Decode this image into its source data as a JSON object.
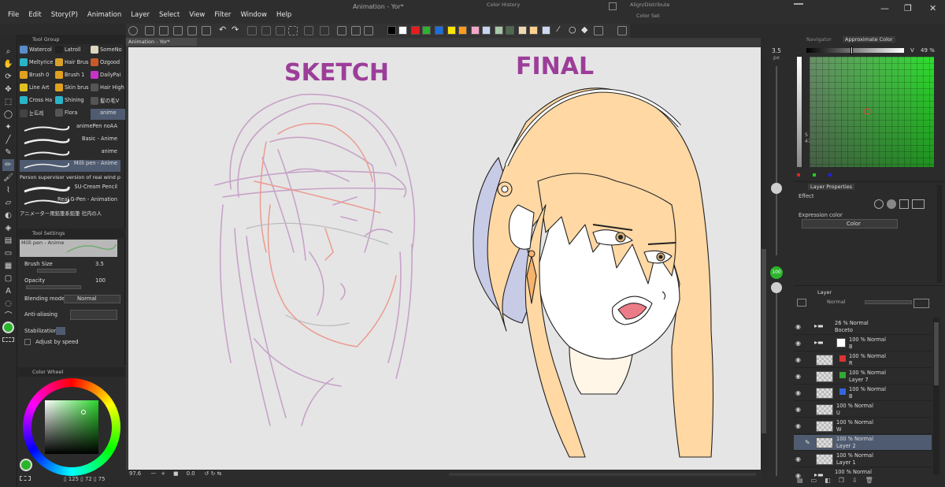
{
  "menu": [
    "File",
    "Edit",
    "Story(P)",
    "Animation",
    "Layer",
    "Select",
    "View",
    "Filter",
    "Window",
    "Help"
  ],
  "window": {
    "title": "Animation - Yor*",
    "color_history_caption": "Color History",
    "align_caption": "Align/Distribute",
    "color_set_caption": "Color Set",
    "controls": [
      "—",
      "❐",
      "✕"
    ]
  },
  "color_set": [
    "#000000",
    "#ffffff",
    "#e81c1c",
    "#2db32d",
    "#1a6fe0",
    "#ffe600",
    "#ff9a1e",
    "#f2a8c8",
    "#c9d6f0",
    "#a8c8a8",
    "#4f6a4f",
    "#f0d8b0",
    "#ffd090",
    "#d0d8f0"
  ],
  "tool_group": {
    "title": "Tool Group",
    "cells": [
      {
        "label": "Watercol",
        "color": "#5a8cc8"
      },
      {
        "label": "Latroll",
        "color": "#222222"
      },
      {
        "label": "SomeNo",
        "color": "#ddd7c0"
      },
      {
        "label": "Meltyrice",
        "color": "#2ab4c8"
      },
      {
        "label": "Hair Brus",
        "color": "#d8a22a"
      },
      {
        "label": "Ozgood",
        "color": "#c85a2a"
      },
      {
        "label": "Brush 0",
        "color": "#e0a020"
      },
      {
        "label": "Brush 1",
        "color": "#e0a020"
      },
      {
        "label": "DailyPai",
        "color": "#c832c8"
      },
      {
        "label": "Line Art",
        "color": "#e0c020"
      },
      {
        "label": "Skin brus",
        "color": "#e0a020"
      },
      {
        "label": "Hair High",
        "color": "#555555"
      },
      {
        "label": "Cross Ha",
        "color": "#2ab4c8"
      },
      {
        "label": "Shining",
        "color": "#2ab4c8"
      },
      {
        "label": "髪の毛V",
        "color": "#555555"
      },
      {
        "label": "눈트레 ",
        "color": "#444444"
      },
      {
        "label": "Flora",
        "color": "#555555"
      },
      {
        "label": "anime",
        "color": "#4f5b70"
      }
    ]
  },
  "brushes": [
    {
      "name": "animePen noAA",
      "selected": false
    },
    {
      "name": "Basic - Anime",
      "selected": false
    },
    {
      "name": "anime",
      "selected": false
    },
    {
      "name": "Milli pen - Anime",
      "selected": true
    },
    {
      "name": "Person supervisor version of real wind pen",
      "selected": false
    },
    {
      "name": "SU-Cream Pencil",
      "selected": false
    },
    {
      "name": "Real G-Pen - Animation",
      "selected": false
    },
    {
      "name": "アニメーター用鉛筆系鉛筆 社内の人",
      "selected": false
    }
  ],
  "tool_settings": {
    "title": "Tool Settings",
    "preset": "Milli pen - Anime",
    "brush_size_label": "Brush Size",
    "brush_size_value": "3.5",
    "opacity_label": "Opacity",
    "opacity_value": "100",
    "blending_label": "Blending mode",
    "blending_value": "Normal",
    "anti_aliasing_label": "Anti-aliasing",
    "stabilization_label": "Stabilization",
    "adjust_speed_label": "Adjust by speed"
  },
  "color_wheel": {
    "title": "Color Wheel",
    "h": "125",
    "s": "72",
    "v": "75",
    "main_color": "#2bb52b"
  },
  "canvas": {
    "tab_label": "Animation - Yor*",
    "sketch_title": "SKETCH",
    "final_title": "FINAL",
    "zoom": "97.6",
    "angle": "0.0"
  },
  "brush_size_strip": {
    "size_value": "3.5",
    "size_unit": "px",
    "opacity_value": "100"
  },
  "navigator": {
    "tab_navigator": "Navigator",
    "tab_approx": "Approximate Color",
    "v_label": "V",
    "v_value": "49",
    "v_unit": "%",
    "s_axis": "S",
    "s_value": "47"
  },
  "layer_properties": {
    "title": "Layer Properties",
    "effect_label": "Effect",
    "expression_label": "Expression color",
    "expression_value": "Color"
  },
  "layer_panel": {
    "title": "Layer",
    "blend_value": "Normal",
    "layers": [
      {
        "opacity": "26 % Normal",
        "name": "Boceto",
        "type": "folder",
        "selected": false
      },
      {
        "opacity": "100 % Normal",
        "name": "B",
        "type": "folder",
        "selected": false
      },
      {
        "opacity": "100 % Normal",
        "name": "R",
        "type": "raster",
        "selected": false
      },
      {
        "opacity": "100 % Normal",
        "name": "Layer 7",
        "type": "raster",
        "selected": false
      },
      {
        "opacity": "100 % Normal",
        "name": "B",
        "type": "raster",
        "selected": false
      },
      {
        "opacity": "100 % Normal",
        "name": "U",
        "type": "raster",
        "selected": false
      },
      {
        "opacity": "100 % Normal",
        "name": "W",
        "type": "raster",
        "selected": false
      },
      {
        "opacity": "100 % Normal",
        "name": "Layer 2",
        "type": "raster",
        "selected": true
      },
      {
        "opacity": "100 % Normal",
        "name": "Layer 1",
        "type": "raster",
        "selected": false
      },
      {
        "opacity": "100 % Normal",
        "name": "",
        "type": "folder",
        "selected": false
      }
    ]
  }
}
